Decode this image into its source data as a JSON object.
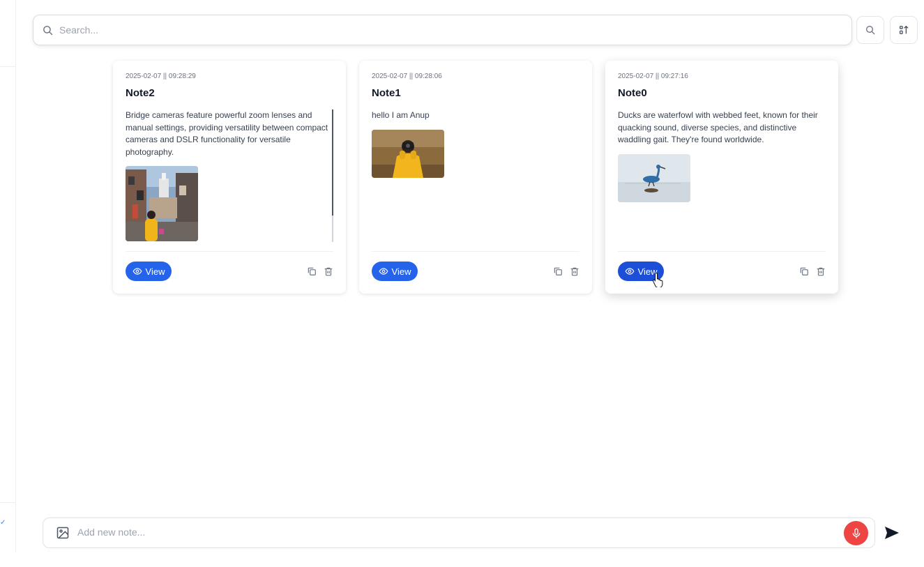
{
  "search": {
    "placeholder": "Search..."
  },
  "toolbar": {
    "search_icon": "search-icon",
    "sort_icon": "sort-icon"
  },
  "notes": [
    {
      "date": "2025-02-07 || 09:28:29",
      "title": "Note2",
      "body": "Bridge cameras feature powerful zoom lenses and manual settings, providing versatility between compact cameras and DSLR functionality for versatile photography.",
      "view_label": "View",
      "image_icon": "street-photo"
    },
    {
      "date": "2025-02-07 || 09:28:06",
      "title": "Note1",
      "body": "hello I am Anup",
      "view_label": "View",
      "image_icon": "photographer-photo"
    },
    {
      "date": "2025-02-07 || 09:27:16",
      "title": "Note0",
      "body": "Ducks are waterfowl with webbed feet, known for their quacking sound, diverse species, and distinctive waddling gait. They're found worldwide.",
      "view_label": "View",
      "image_icon": "heron-photo"
    }
  ],
  "composer": {
    "placeholder": "Add new note..."
  },
  "colors": {
    "accent": "#2563eb",
    "mic": "#ef4444",
    "text": "#1f2937"
  }
}
